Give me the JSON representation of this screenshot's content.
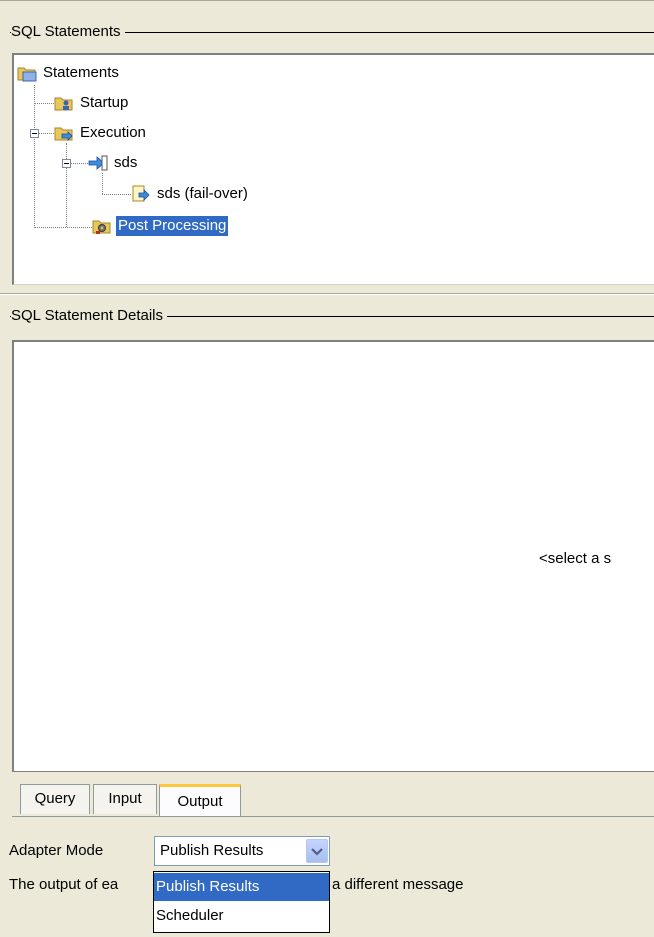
{
  "sql_statements": {
    "group_title": "SQL Statements",
    "tree": {
      "root": "Statements",
      "startup": "Startup",
      "execution": "Execution",
      "sds": "sds",
      "sds_failover": "sds (fail-over)",
      "post_processing": "Post Processing"
    }
  },
  "details": {
    "group_title": "SQL Statement Details",
    "placeholder": "<select a s"
  },
  "tabs": [
    {
      "label": "Query"
    },
    {
      "label": "Input"
    },
    {
      "label": "Output",
      "active": true
    }
  ],
  "adapter_mode": {
    "label": "Adapter Mode",
    "selected": "Publish Results",
    "options": [
      "Publish Results",
      "Scheduler"
    ]
  },
  "help_text": {
    "before": "The output of ea",
    "after": "a different message"
  },
  "colors": {
    "selection": "#316AC5",
    "active_tab_accent": "#FFC83C",
    "window_bg": "#ECE9D8"
  }
}
